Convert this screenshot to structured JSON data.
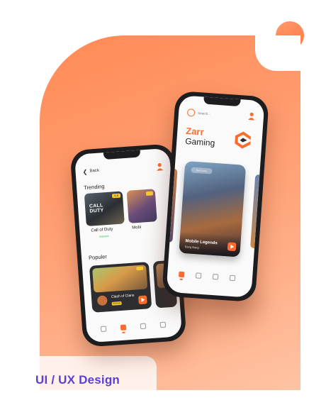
{
  "banner": {
    "label": "UI / UX Design"
  },
  "left_phone": {
    "back_label": "Back",
    "trending_title": "Trending",
    "popular_title": "Populer",
    "trending": [
      {
        "name": "Call of Duty",
        "sub": "Garena",
        "logo_line1": "CALL",
        "logo_line2": "DUTY"
      },
      {
        "name": "Mobi",
        "sub": ""
      }
    ],
    "popular": [
      {
        "name": "Clash of Clans",
        "tag": "Strategy"
      }
    ]
  },
  "right_phone": {
    "search_placeholder": "Search...",
    "brand_line1": "Zarr",
    "brand_line2": "Gaming",
    "hero_tag": "Best Game",
    "hero": {
      "title": "Mobile Legends",
      "sub": "Bang Bang"
    }
  },
  "colors": {
    "accent": "#ff6b2c",
    "label": "#5b3fd6",
    "background": "#ff8a56"
  },
  "icons": [
    "back-icon",
    "user-icon",
    "search-icon",
    "play-icon",
    "home-icon",
    "game-icon",
    "cart-icon",
    "profile-icon",
    "brand-logo-icon"
  ]
}
